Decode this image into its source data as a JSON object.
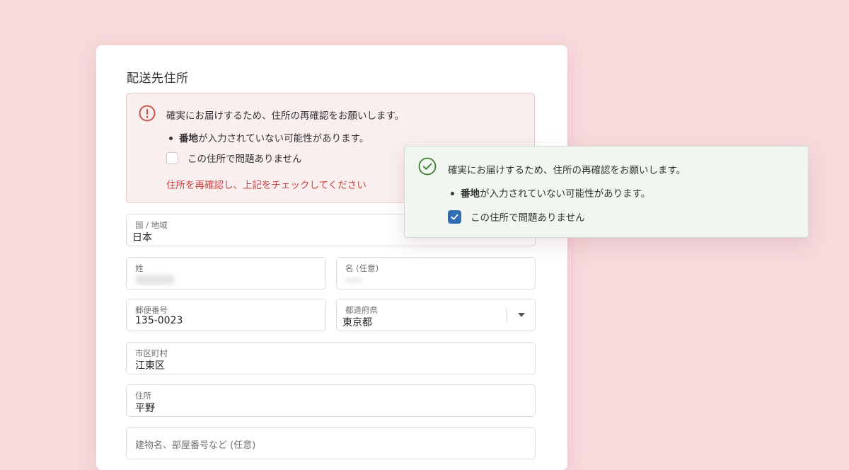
{
  "form": {
    "title": "配送先住所",
    "alert": {
      "message": "確実にお届けするため、住所の再確認をお願いします。",
      "bullet_bold": "番地",
      "bullet_rest": "が入力されていない可能性があります。",
      "checkbox_label": "この住所で問題ありません",
      "checkbox_checked": false,
      "error_text": "住所を再確認し、上記をチェックしてください",
      "icon": "exclamation-circle-icon",
      "color": "#d14343"
    },
    "fields": {
      "country": {
        "label": "国 / 地域",
        "value": "日本"
      },
      "last_name": {
        "label": "姓",
        "value": ""
      },
      "first_name": {
        "label": "名 (任意)",
        "value": ""
      },
      "postal_code": {
        "label": "郵便番号",
        "value": "135-0023"
      },
      "prefecture": {
        "label": "都道府県",
        "value": "東京都"
      },
      "city": {
        "label": "市区町村",
        "value": "江東区"
      },
      "address": {
        "label": "住所",
        "value": "平野"
      },
      "building": {
        "label": "建物名、部屋番号など (任意)",
        "value": ""
      }
    }
  },
  "confirmed_panel": {
    "message": "確実にお届けするため、住所の再確認をお願いします。",
    "bullet_bold": "番地",
    "bullet_rest": "が入力されていない可能性があります。",
    "checkbox_label": "この住所で問題ありません",
    "checkbox_checked": true,
    "icon": "check-circle-icon",
    "color": "#3a7d2c",
    "checkbox_color": "#2f6db5"
  },
  "colors": {
    "background": "#f8dadd",
    "error": "#d14343",
    "success": "#3a7d2c"
  }
}
